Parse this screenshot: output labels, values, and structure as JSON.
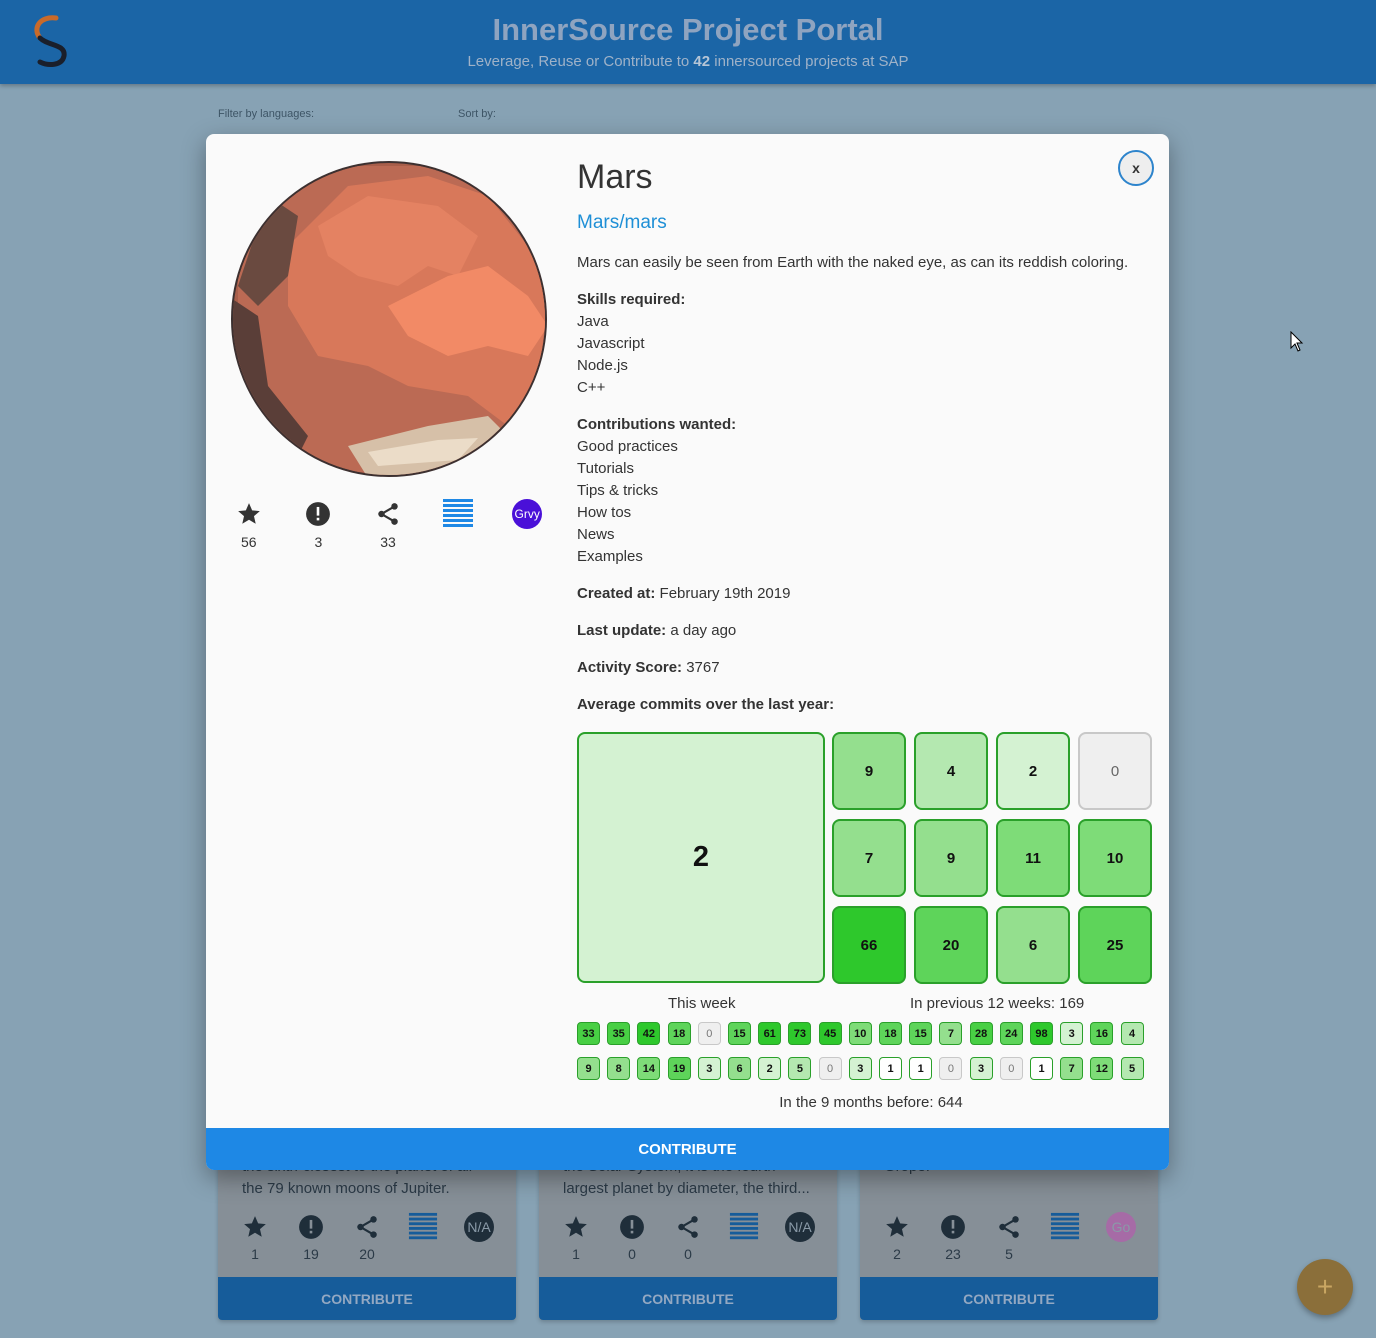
{
  "header": {
    "title": "InnerSource Project Portal",
    "subtitle_pre": "Leverage, Reuse or Contribute to ",
    "subtitle_count": "42",
    "subtitle_post": " innersourced projects at SAP"
  },
  "filters": {
    "languages_label": "Filter by languages:",
    "sort_label": "Sort by:"
  },
  "background_cards": [
    {
      "desc_line1": "the sixth-closest to the planet of all",
      "desc_line2": "the 79 known moons of Jupiter.",
      "stars": "1",
      "issues": "19",
      "forks": "20",
      "badge": "N/A",
      "badge_color": "#1f2e3a",
      "contribute": "CONTRIBUTE"
    },
    {
      "desc_line1": "the Solar System, it is the fourth-",
      "desc_line2": "largest planet by diameter, the third...",
      "stars": "1",
      "issues": "0",
      "forks": "0",
      "badge": "N/A",
      "badge_color": "#1f2e3a",
      "contribute": "CONTRIBUTE"
    },
    {
      "desc_line1": "Grope.",
      "desc_line2": "",
      "stars": "2",
      "issues": "23",
      "forks": "5",
      "badge": "Go",
      "badge_color": "#a66ba6",
      "contribute": "CONTRIBUTE"
    }
  ],
  "modal": {
    "close_label": "x",
    "name": "Mars",
    "repo": "Mars/mars",
    "description": "Mars can easily be seen from Earth with the naked eye, as can its reddish coloring.",
    "stats": {
      "stars": "56",
      "issues": "3",
      "forks": "33",
      "badge": "Grvy",
      "badge_color": "#4a10d8"
    },
    "skills_label": "Skills required:",
    "skills": [
      "Java",
      "Javascript",
      "Node.js",
      "C++"
    ],
    "contributions_label": "Contributions wanted:",
    "contributions": [
      "Good practices",
      "Tutorials",
      "Tips & tricks",
      "How tos",
      "News",
      "Examples"
    ],
    "created_label": "Created at:",
    "created_value": "February 19th 2019",
    "updated_label": "Last update:",
    "updated_value": "a day ago",
    "score_label": "Activity Score:",
    "score_value": "3767",
    "commits_label": "Average commits over the last year:",
    "this_week": "2",
    "previous_weeks": [
      "9",
      "4",
      "2",
      "0",
      "7",
      "9",
      "11",
      "10",
      "66",
      "20",
      "6",
      "25"
    ],
    "this_week_caption": "This week",
    "previous_caption": "In previous 12 weeks: 169",
    "older_row1": [
      "33",
      "35",
      "42",
      "18",
      "0",
      "15",
      "61",
      "73",
      "45",
      "10",
      "18",
      "15",
      "7",
      "28",
      "24",
      "98",
      "3",
      "16",
      "4"
    ],
    "older_row2": [
      "9",
      "8",
      "14",
      "19",
      "3",
      "6",
      "2",
      "5",
      "0",
      "3",
      "1",
      "1",
      "0",
      "3",
      "0",
      "1",
      "7",
      "12",
      "5"
    ],
    "older_caption": "In the 9 months before: 644",
    "contribute": "CONTRIBUTE"
  },
  "fab_label": "+"
}
